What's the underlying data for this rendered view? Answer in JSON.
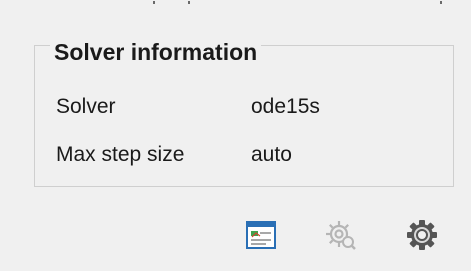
{
  "solver_panel": {
    "title": "Solver information",
    "rows": [
      {
        "label": "Solver",
        "value": "ode15s"
      },
      {
        "label": "Max step size",
        "value": "auto"
      }
    ]
  },
  "toolbar": {
    "icons": [
      {
        "name": "report-icon",
        "enabled": true
      },
      {
        "name": "gear-search-icon",
        "enabled": false
      },
      {
        "name": "settings-gear-icon",
        "enabled": true
      }
    ]
  },
  "colors": {
    "background": "#f0f0f0",
    "border": "#cfcfcf",
    "text": "#1a1a1a",
    "icon_blue": "#2a6fb5",
    "icon_disabled": "#b5b5b5",
    "icon_gear": "#555555"
  }
}
